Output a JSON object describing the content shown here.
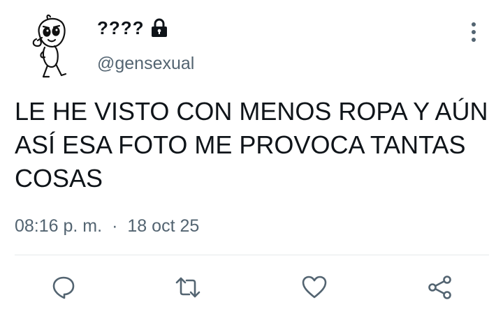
{
  "user": {
    "display_name": "????",
    "handle": "@gensexual",
    "protected_icon": "lock-icon",
    "avatar_icon": "cartoon-character-avatar"
  },
  "tweet": {
    "lines": [
      "LE HE VISTO CON MENOS ROPA Y AÚN",
      "ASÍ ESA FOTO ME PROVOCA TANTAS",
      "COSAS"
    ],
    "time": "08:16 p. m.",
    "separator": "·",
    "date": "18 oct 25"
  },
  "actions": {
    "reply_icon": "reply-icon",
    "retweet_icon": "retweet-icon",
    "like_icon": "heart-icon",
    "share_icon": "share-icon"
  },
  "colors": {
    "text": "#0f1419",
    "secondary": "#536471",
    "divider": "#e6e9eb"
  }
}
